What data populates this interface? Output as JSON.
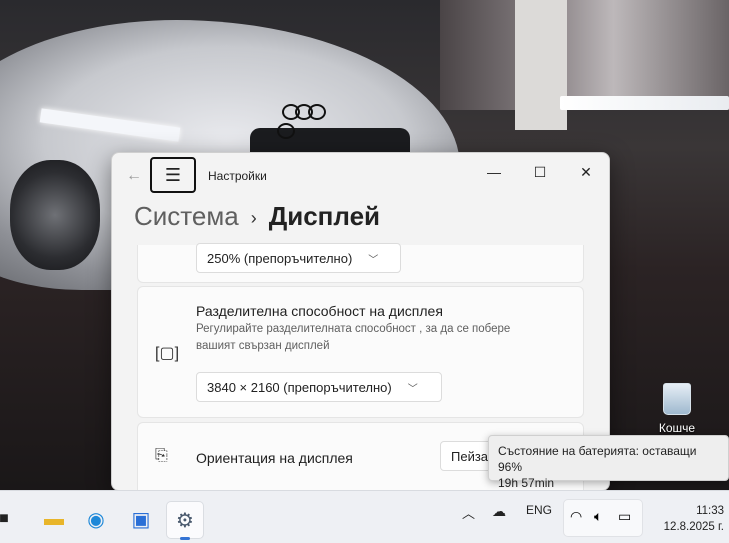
{
  "desktop": {
    "recycle_bin_label": "Кошче"
  },
  "window": {
    "app_title": "Настройки",
    "breadcrumb_root": "Система",
    "breadcrumb_separator": "›",
    "breadcrumb_current": "Дисплей",
    "controls": {
      "minimize": "—",
      "maximize": "☐",
      "close": "✕"
    }
  },
  "scale": {
    "value": "250% (препоръчително)"
  },
  "resolution": {
    "title": "Разделителна способност на дисплея",
    "description": "Регулирайте разделителната способност , за да се побере вашият свързан дисплей",
    "value": "3840 × 2160 (препоръчително)"
  },
  "orientation": {
    "title": "Ориентация на дисплея",
    "value": "Пейза"
  },
  "tooltip": {
    "line1": "Състояние на батерията: оставащи 96%",
    "line2": "19h 57min"
  },
  "taskbar": {
    "language": "ENG",
    "time": "11:33",
    "date": "12.8.2025 г."
  },
  "colors": {
    "accent": "#3574d4",
    "window_bg": "#f3f3f3",
    "taskbar_bg": "#eef0f4"
  },
  "icons": [
    "back-arrow-icon",
    "hamburger-menu-icon",
    "resolution-icon",
    "orientation-icon",
    "recycle-bin-icon",
    "file-explorer-icon",
    "edge-icon",
    "store-icon",
    "settings-icon",
    "chevron-up-icon",
    "cloud-off-icon",
    "wifi-icon",
    "volume-icon",
    "battery-icon"
  ]
}
